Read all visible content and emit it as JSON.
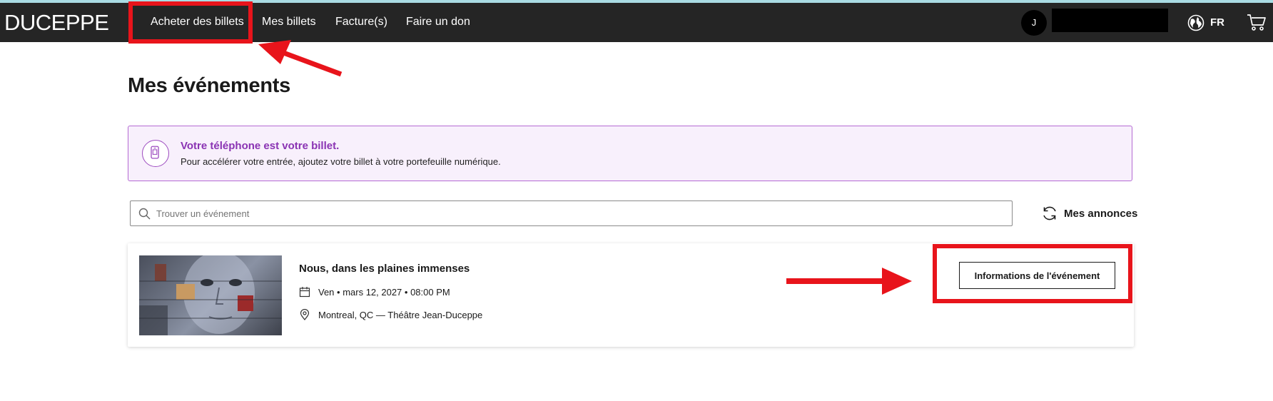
{
  "brand": {
    "logo_text": "DUCEPPE"
  },
  "nav": {
    "links": [
      {
        "label": "Acheter des billets"
      },
      {
        "label": "Mes billets"
      },
      {
        "label": "Facture(s)"
      },
      {
        "label": "Faire un don"
      }
    ],
    "user_initial": "J",
    "language": "FR"
  },
  "page": {
    "title": "Mes événements"
  },
  "banner": {
    "title": "Votre téléphone est votre billet.",
    "text": "Pour accélérer votre entrée, ajoutez votre billet à votre portefeuille numérique."
  },
  "search": {
    "placeholder": "Trouver un événement",
    "value": ""
  },
  "listings": {
    "label": "Mes annonces"
  },
  "event": {
    "name": "Nous, dans les plaines immenses",
    "date": "Ven • mars 12, 2027 • 08:00 PM",
    "venue": "Montreal, QC — Théâtre Jean-Duceppe",
    "button_label": "Informations de l'événement"
  },
  "colors": {
    "nav_bg": "#252525",
    "banner_accent": "#8a33b3",
    "annotation_red": "#e8141b"
  }
}
